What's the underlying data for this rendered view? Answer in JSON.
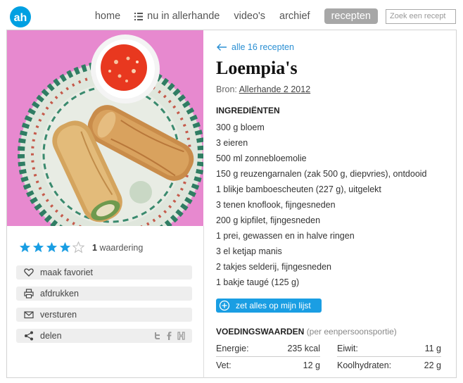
{
  "header": {
    "logo_text": "ah",
    "nav": [
      {
        "label": "home"
      },
      {
        "label": "nu in allerhande"
      },
      {
        "label": "video's"
      },
      {
        "label": "archief"
      },
      {
        "label": "recepten"
      }
    ],
    "search_placeholder": "Zoek een recept"
  },
  "recipe": {
    "back_label": "alle 16 recepten",
    "title": "Loempia's",
    "source_label": "Bron:",
    "source_link": "Allerhande 2 2012",
    "ingredients_heading": "INGREDIËNTEN",
    "ingredients": [
      "300 g bloem",
      "3 eieren",
      "500 ml zonnebloemolie",
      "150 g reuzengarnalen (zak 500 g, diepvries), ontdooid",
      "1 blikje bamboescheuten (227 g), uitgelekt",
      "3 tenen knoflook, fijngesneden",
      "200 g kipfilet, fijngesneden",
      "1 prei, gewassen en in halve ringen",
      "3 el ketjap manis",
      "2 takjes selderij, fijngesneden",
      "1 bakje taugé (125 g)"
    ],
    "add_button": "zet alles op mijn lijst",
    "nutrition_heading": "VOEDINGSWAARDEN",
    "nutrition_sub": "(per eenpersoonsportie)",
    "nutrition": [
      [
        {
          "label": "Energie:",
          "value": "235 kcal"
        },
        {
          "label": "Eiwit:",
          "value": "11 g"
        }
      ],
      [
        {
          "label": "Vet:",
          "value": "12 g"
        },
        {
          "label": "Koolhydraten:",
          "value": "22 g"
        }
      ]
    ]
  },
  "sidebar": {
    "rating": {
      "value": 4,
      "max": 5,
      "count": "1",
      "count_label": "waardering"
    },
    "actions": [
      {
        "label": "maak favoriet",
        "icon": "heart-icon"
      },
      {
        "label": "afdrukken",
        "icon": "printer-icon"
      },
      {
        "label": "versturen",
        "icon": "envelope-icon"
      },
      {
        "label": "delen",
        "icon": "share-icon"
      }
    ],
    "share_icons": [
      "twitter-icon",
      "facebook-icon",
      "hyves-icon"
    ]
  },
  "colors": {
    "accent": "#1a9ee3",
    "logo": "#00a0e2",
    "active_tab": "#a7a7a7",
    "star_filled": "#1a9ee3",
    "photo_background": "#e789cf"
  }
}
